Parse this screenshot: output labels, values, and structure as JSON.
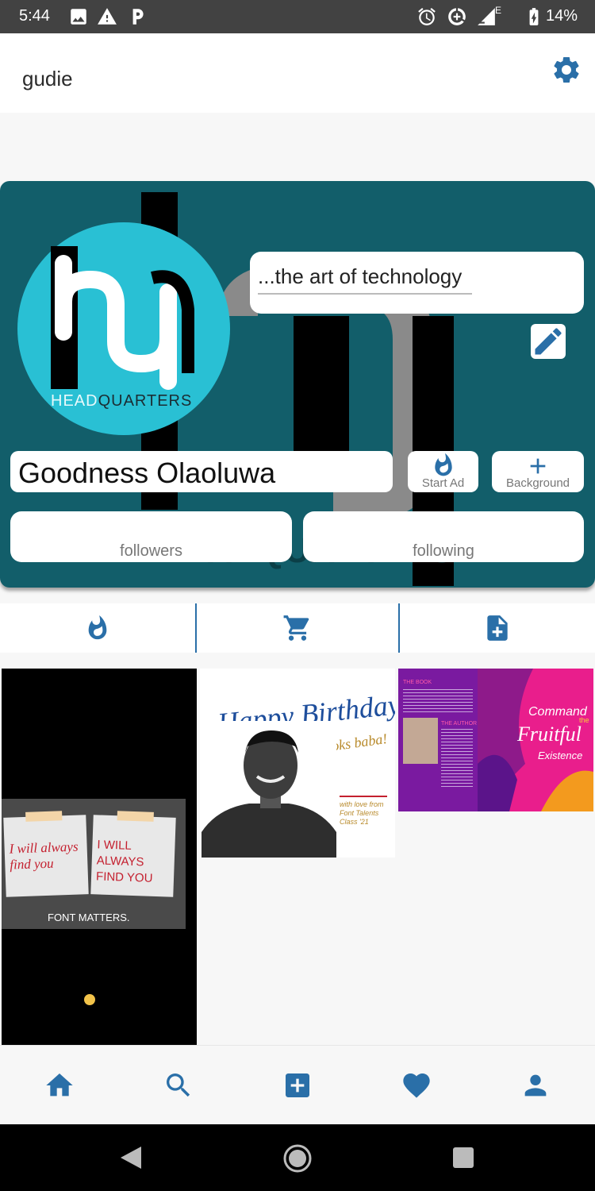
{
  "status_bar": {
    "time": "5:44",
    "network_badge": "E",
    "battery": "14%",
    "icons": [
      "image-icon",
      "warning-icon",
      "parking-icon",
      "alarm-icon",
      "data-saver-icon",
      "signal-icon",
      "battery-icon"
    ]
  },
  "header": {
    "username": "gudie",
    "settings_icon": "gear-icon"
  },
  "profile": {
    "logo_text_head": "HEAD",
    "logo_text_quarters": "QUARTERS",
    "tagline": "...the art of technology",
    "display_name": "Goodness Olaoluwa",
    "start_ad_label": "Start Ad",
    "background_label": "Background",
    "followers_label": "followers",
    "following_label": "following"
  },
  "tabs": [
    {
      "name": "tab-posts",
      "icon": "flame-icon"
    },
    {
      "name": "tab-shop",
      "icon": "cart-icon"
    },
    {
      "name": "tab-documents",
      "icon": "note-add-icon"
    }
  ],
  "posts": {
    "post1": {
      "note_left": "I will always find you",
      "note_right": "I WILL ALWAYS FIND YOU",
      "caption": "FONT MATTERS."
    },
    "post2": {
      "headline": "Happy Birthday",
      "subline": "Otoks baba!",
      "signoff": "with love from Font Talents Class '21"
    },
    "post3": {
      "book_heading": "THE BOOK",
      "author_heading": "THE AUTHOR",
      "title_command": "Command",
      "title_the": "the",
      "title_fruitful": "Fruitful",
      "title_existence": "Existence"
    }
  },
  "bottom_nav": [
    "home-icon",
    "search-icon",
    "add-box-icon",
    "heart-icon",
    "person-icon"
  ],
  "colors": {
    "accent": "#2a6fa8",
    "card_bg": "#125e6a",
    "logo_cyan": "#29c0d4",
    "status_bar": "#424242"
  }
}
